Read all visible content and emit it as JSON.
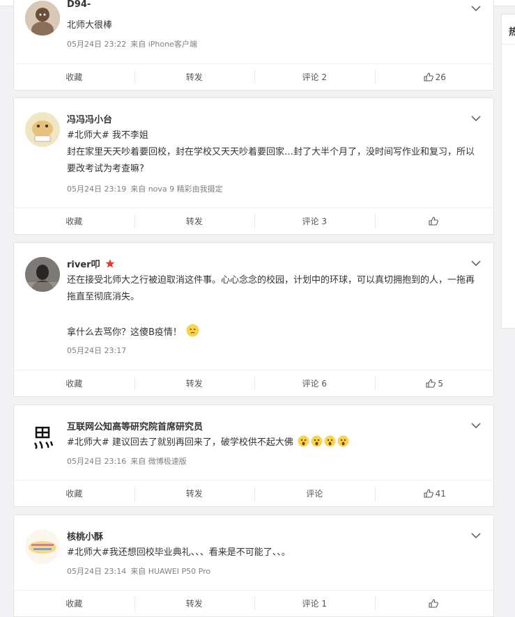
{
  "posts": [
    {
      "name": "D94-",
      "text": "北师大很棒",
      "date": "05月24日 23:22",
      "source": "来自 iPhone客户端",
      "actions": {
        "fav": "收藏",
        "repost": "转发",
        "comment": "评论 2",
        "like": "26"
      }
    },
    {
      "name": "冯冯冯小台",
      "line1": "#北师大# 我不李姐",
      "text": "封在家里天天吵着要回校，封在学校又天天吵着要回家…封了大半个月了，没时间写作业和复习，所以要改考试为考查嘛?",
      "date": "05月24日 23:19",
      "source": "来自 nova 9 精彩由我摄定",
      "actions": {
        "fav": "收藏",
        "repost": "转发",
        "comment": "评论 3",
        "like": ""
      }
    },
    {
      "name": "river叩",
      "text": "还在接受北师大之行被迫取消这件事。心心念念的校园，计划中的环球，可以真切拥抱到的人，一拖再拖直至彻底消失。",
      "text2": "拿什么去骂你？这傻B疫情！",
      "date": "05月24日 23:17",
      "source": "",
      "actions": {
        "fav": "收藏",
        "repost": "转发",
        "comment": "评论 6",
        "like": "5"
      }
    },
    {
      "name": "互联网公知高等研究院首席研究员",
      "text": "#北师大# 建议回去了就别再回来了，破学校供不起大佛",
      "date": "05月24日 23:16",
      "source": "来自 微博极速版",
      "actions": {
        "fav": "收藏",
        "repost": "转发",
        "comment": "评论",
        "like": "41"
      }
    },
    {
      "name": "核桃小酥",
      "text": "#北师大#我还想回校毕业典礼、、、看来是不可能了、、。",
      "date": "05月24日 23:14",
      "source": "来自 HUAWEI P50 Pro",
      "actions": {
        "fav": "收藏",
        "repost": "转发",
        "comment": "评论 1",
        "like": ""
      }
    }
  ],
  "sidebar": {
    "heading": "热"
  },
  "colors": {
    "accent": "#e86b2d",
    "meta": "#808080",
    "background": "#f2f2f5"
  }
}
